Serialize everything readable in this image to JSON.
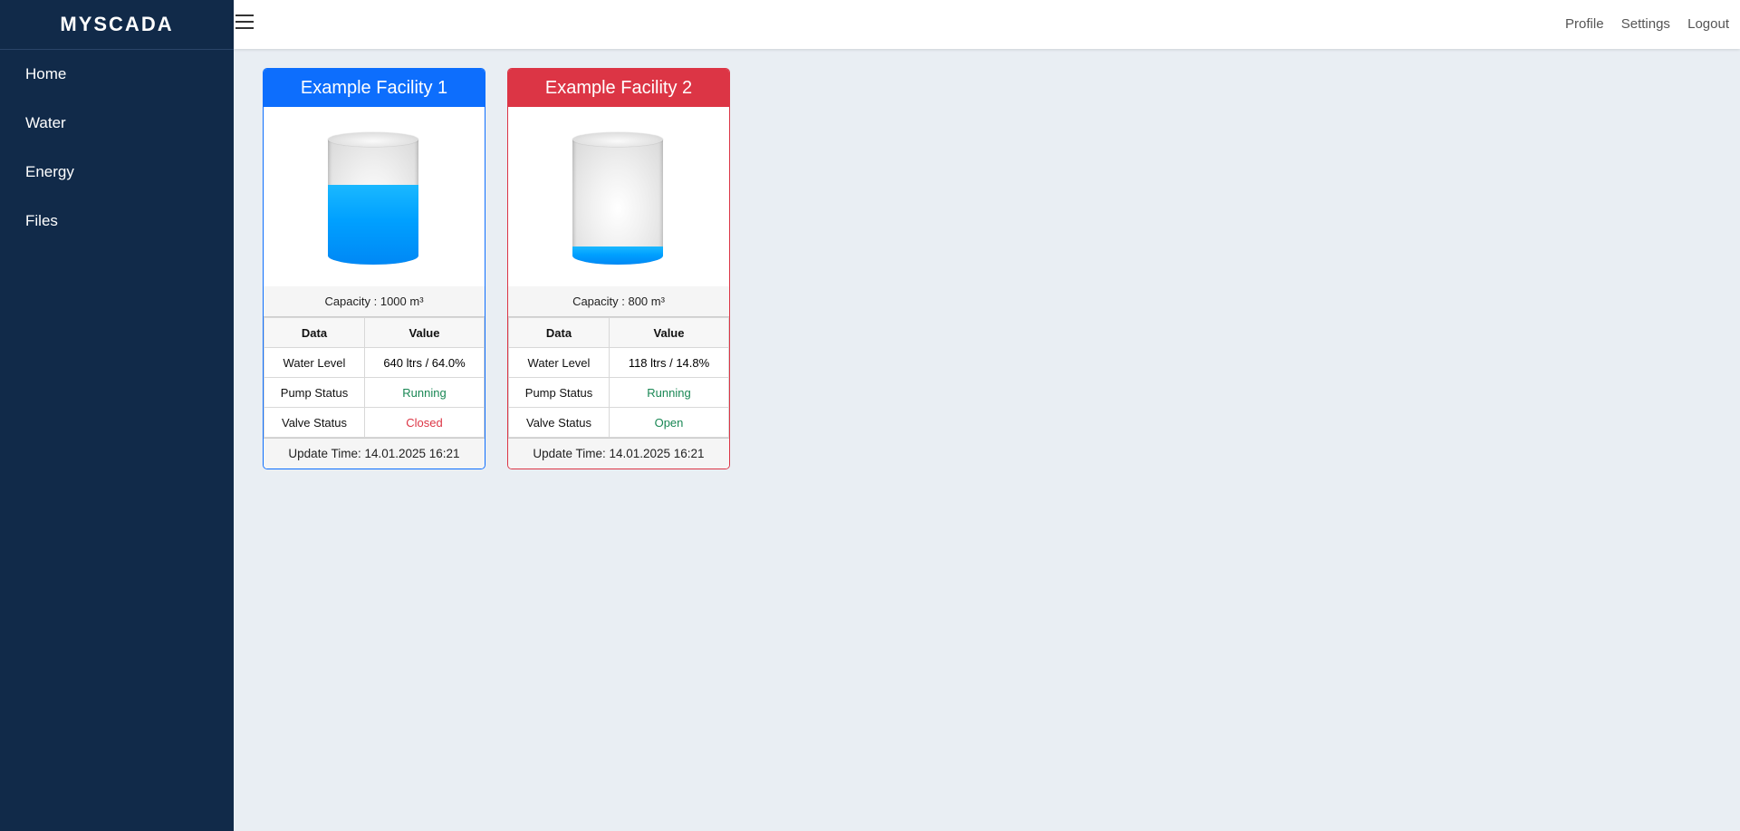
{
  "app": {
    "brand": "MYSCADA"
  },
  "sidebar": {
    "items": [
      {
        "label": "Home"
      },
      {
        "label": "Water"
      },
      {
        "label": "Energy"
      },
      {
        "label": "Files"
      }
    ]
  },
  "topbar": {
    "menu_icon": "hamburger-icon",
    "links": [
      {
        "label": "Profile"
      },
      {
        "label": "Settings"
      },
      {
        "label": "Logout"
      }
    ]
  },
  "facilities": [
    {
      "title": "Example Facility 1",
      "header_color": "#0d6efd",
      "capacity": "Capacity : 1000 m³",
      "fill_fraction": 0.64,
      "table_headers": [
        "Data",
        "Value"
      ],
      "rows": [
        {
          "label": "Water Level",
          "value": "640 ltrs / 64.0%",
          "status": "neutral"
        },
        {
          "label": "Pump Status",
          "value": "Running",
          "status": "ok"
        },
        {
          "label": "Valve Status",
          "value": "Closed",
          "status": "bad"
        }
      ],
      "update_time": "Update Time: 14.01.2025 16:21"
    },
    {
      "title": "Example Facility 2",
      "header_color": "#dc3545",
      "capacity": "Capacity : 800 m³",
      "fill_fraction": 0.148,
      "table_headers": [
        "Data",
        "Value"
      ],
      "rows": [
        {
          "label": "Water Level",
          "value": "118 ltrs / 14.8%",
          "status": "neutral"
        },
        {
          "label": "Pump Status",
          "value": "Running",
          "status": "ok"
        },
        {
          "label": "Valve Status",
          "value": "Open",
          "status": "ok"
        }
      ],
      "update_time": "Update Time: 14.01.2025 16:21"
    }
  ]
}
